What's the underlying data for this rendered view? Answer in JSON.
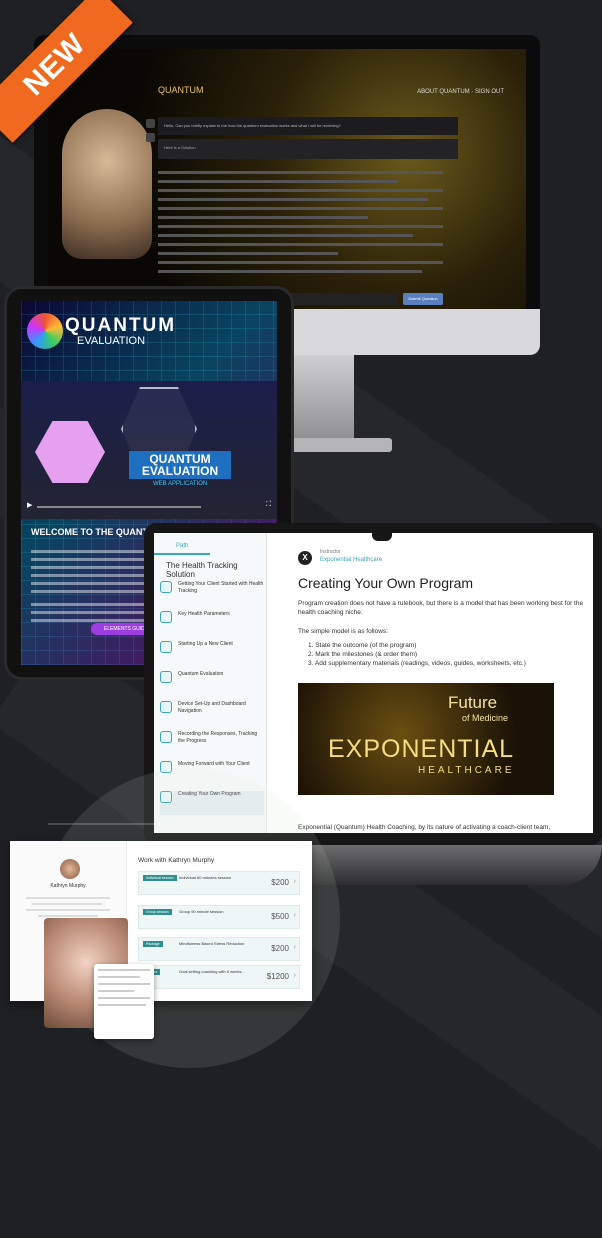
{
  "ribbon": {
    "label": "NEW"
  },
  "desktop": {
    "logo": "QUANTUM",
    "nav": "ABOUT QUANTUM · SIGN OUT",
    "question": "Hello. Can you briefly explain to me how the quantum evaluation works and what I will be receiving?",
    "answer_label": "Here is a Solution",
    "input_placeholder": "Write down your question",
    "submit_label": "Submit Question"
  },
  "tablet": {
    "brand_title": "QUANTUM",
    "brand_sub": "EVALUATION",
    "video_title": "QUANTUM EVALUATION",
    "video_sub": "WEB APPLICATION",
    "welcome": "WELCOME TO THE QUANTUM",
    "cta": "ELEMENTS GUIDE"
  },
  "laptop": {
    "tab": "Path",
    "track_title": "The Health Tracking Solution",
    "lessons": [
      "Getting Your Client Started with Health Tracking",
      "Key Health Parameters",
      "Starting Up a New Client",
      "Quantum Evaluation",
      "Device Set-Up and Dashboard Navigation",
      "Recording the Responses, Tracking the Progress",
      "Moving Forward with Your Client",
      "Creating Your Own Program"
    ],
    "instructor_label": "Instructor",
    "instructor_name": "Exponential Healthcare",
    "content_title": "Creating Your Own Program",
    "intro": "Program creation does not have a rulebook, but there is a model that has been working best for the health coaching niche.",
    "model_intro": "The simple model is as follows:",
    "steps": [
      "1. State the outcome (of the program)",
      "2. Mark the milestones (& order them)",
      "3. Add supplementary materials (readings, videos, guides, worksheets, etc.)"
    ],
    "banner": {
      "future": "Future",
      "of_medicine": "of Medicine",
      "exponential": "EXPONENTIAL",
      "healthcare": "HEALTHCARE"
    },
    "footer_text": "Exponential (Quantum) Health Coaching, by its nature of activating a coach-client team,"
  },
  "coach": {
    "name": "Kathryn Murphy",
    "work_title": "Work with Kathryn Murphy",
    "offers": [
      {
        "tag": "Individual session",
        "title": "Individual 60 minutes session",
        "price": "$200"
      },
      {
        "tag": "Group session",
        "title": "Group 90 minute session",
        "price": "$500"
      },
      {
        "tag": "Package",
        "title": "Mindfulness Based Stress Reduction",
        "price": "$200"
      },
      {
        "tag": "Course",
        "title": "Goal setting coaching with 6 weeks...",
        "price": "$1200"
      }
    ]
  }
}
